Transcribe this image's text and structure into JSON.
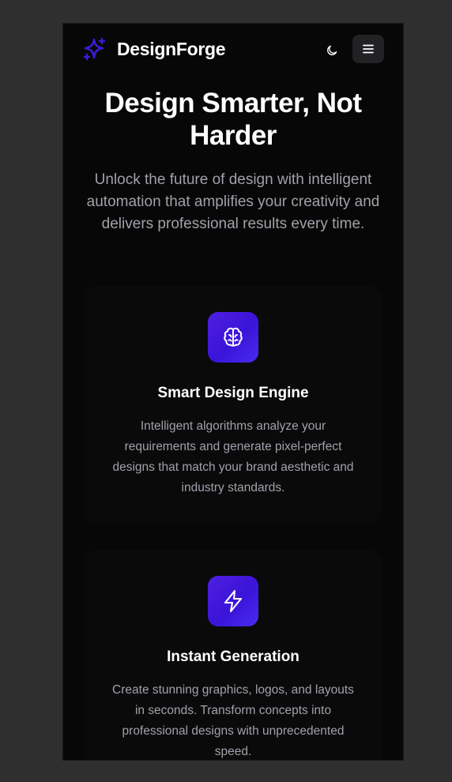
{
  "brand": {
    "name": "DesignForge",
    "logo_icon": "sparkles-icon",
    "accent": "#3b1bd6"
  },
  "nav": {
    "theme_toggle_icon": "moon-icon",
    "menu_icon": "hamburger-menu-icon"
  },
  "hero": {
    "title": "Design Smarter, Not Harder",
    "subtitle": "Unlock the future of design with intelligent automation that amplifies your creativity and delivers professional results every time."
  },
  "features": [
    {
      "icon": "brain-icon",
      "title": "Smart Design Engine",
      "description": "Intelligent algorithms analyze your requirements and generate pixel-perfect designs that match your brand aesthetic and industry standards."
    },
    {
      "icon": "lightning-bolt-icon",
      "title": "Instant Generation",
      "description": "Create stunning graphics, logos, and layouts in seconds. Transform concepts into professional designs with unprecedented speed."
    }
  ]
}
